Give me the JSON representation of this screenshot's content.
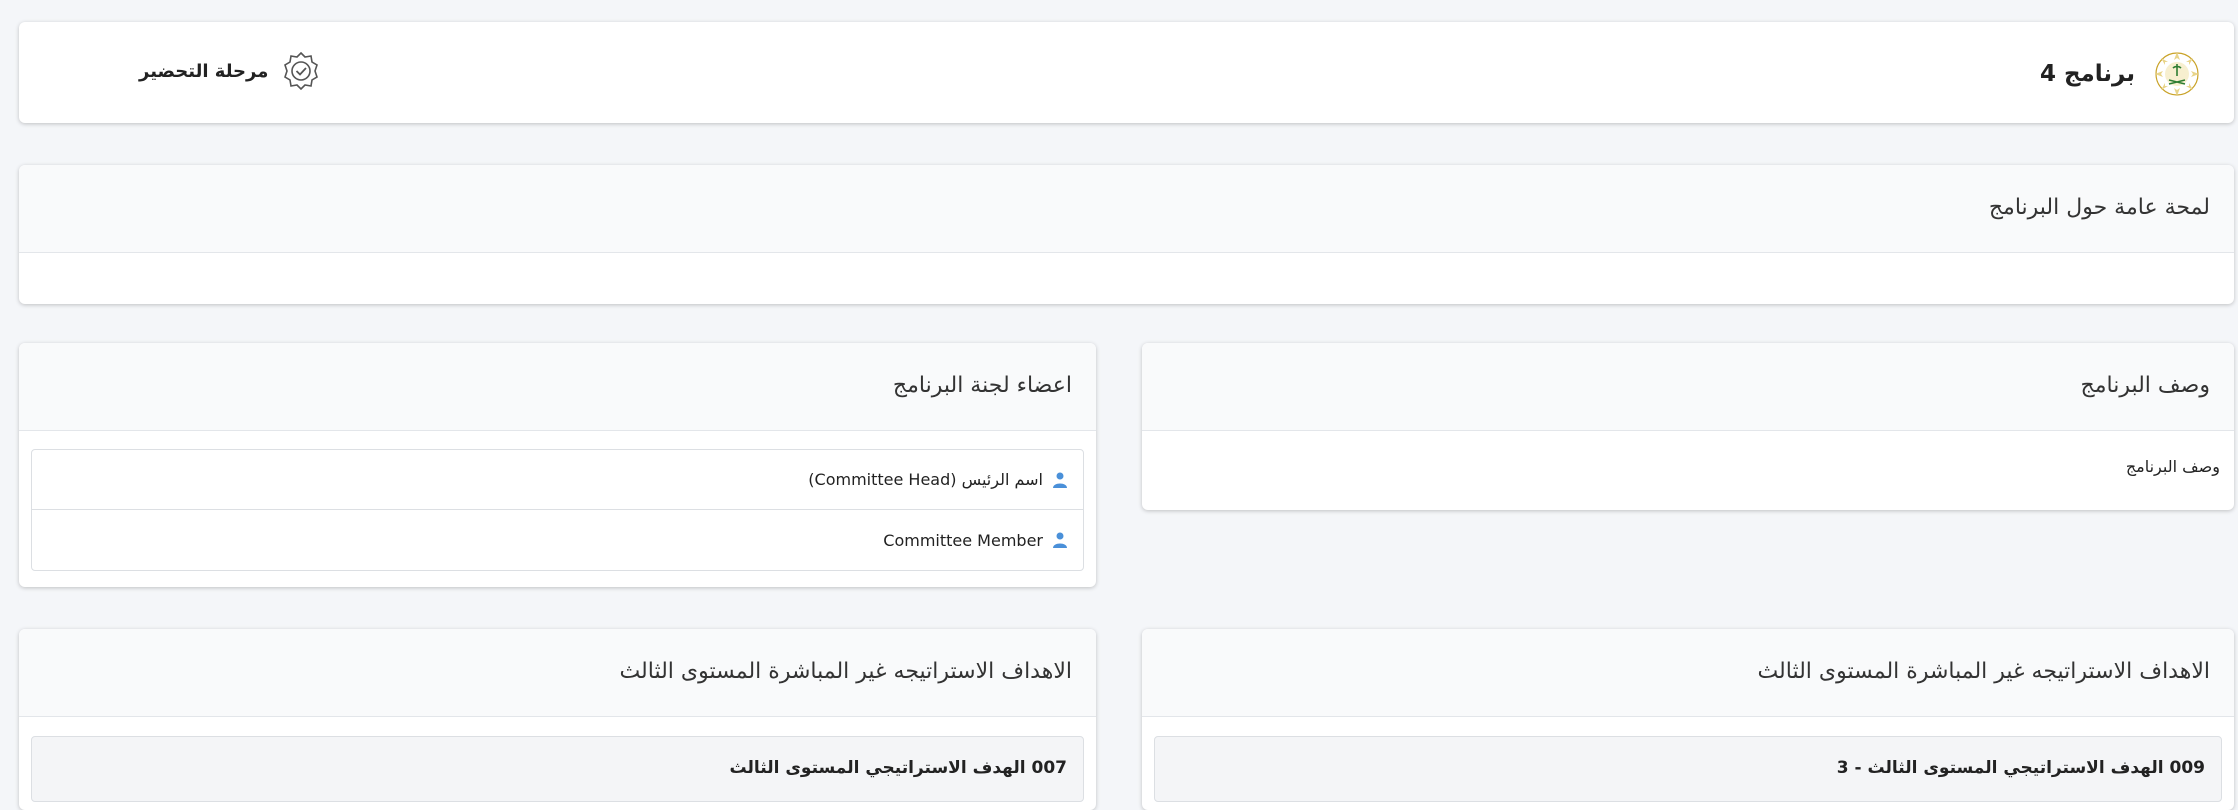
{
  "header": {
    "program_title": "برنامج 4",
    "phase_label": "مرحلة التحضير"
  },
  "overview": {
    "title": "لمحة عامة حول البرنامج",
    "body": ""
  },
  "description": {
    "title": "وصف البرنامج",
    "body": "وصف البرنامج"
  },
  "committee": {
    "title": "اعضاء لجنة البرنامج",
    "members": [
      {
        "name": "اسم الرئيس (Committee Head)",
        "icon": "user-icon"
      },
      {
        "name": "Committee Member",
        "icon": "user-icon"
      }
    ]
  },
  "goals_right": {
    "title": "الاهداف الاستراتيجه غير المباشرة المستوى الثالث",
    "item": "009 الهدف الاستراتيجي المستوى الثالث - 3"
  },
  "goals_left": {
    "title": "الاهداف الاستراتيجه غير المباشرة المستوى الثالث",
    "item": "007 الهدف الاستراتيجي المستوى الثالث"
  },
  "colors": {
    "background": "#f4f6f9",
    "accent": "#4a90d9",
    "emblem_gold": "#c9a227"
  }
}
